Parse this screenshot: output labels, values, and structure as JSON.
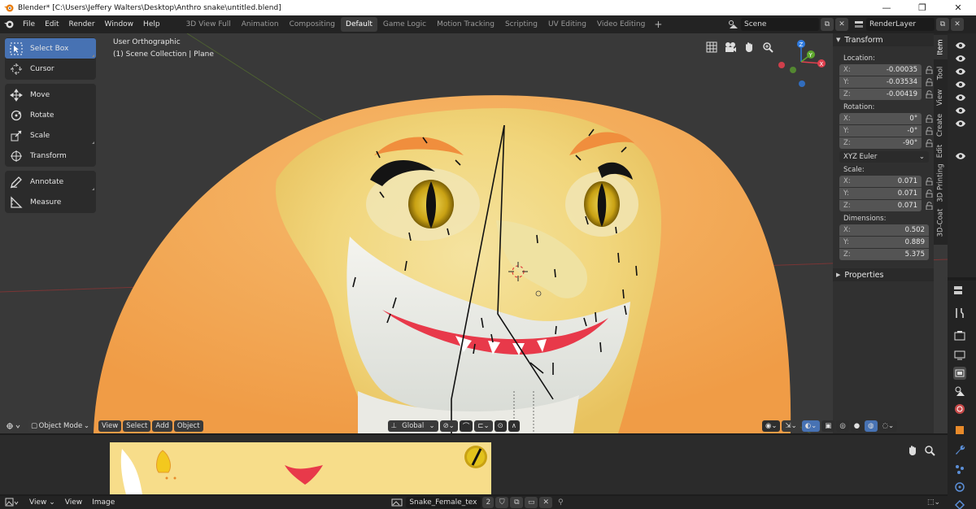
{
  "titlebar": {
    "title": "Blender* [C:\\Users\\Jeffery Walters\\Desktop\\Anthro snake\\untitled.blend]",
    "minimize": "—",
    "maximize": "❐",
    "close": "✕"
  },
  "menus": [
    "File",
    "Edit",
    "Render",
    "Window",
    "Help"
  ],
  "workspaces": [
    "3D View Full",
    "Animation",
    "Compositing",
    "Default",
    "Game Logic",
    "Motion Tracking",
    "Scripting",
    "UV Editing",
    "Video Editing"
  ],
  "active_workspace": "Default",
  "workspace_add": "+",
  "scene": {
    "name": "Scene",
    "render_layer": "RenderLayer"
  },
  "viewport": {
    "view_name": "User Orthographic",
    "collection_info": "(1) Scene Collection | Plane",
    "mode": "Object Mode",
    "menus": [
      "View",
      "Select",
      "Add",
      "Object"
    ],
    "transform_orientation": "Global"
  },
  "tools": {
    "select_box": "Select Box",
    "cursor": "Cursor",
    "move": "Move",
    "rotate": "Rotate",
    "scale": "Scale",
    "transform": "Transform",
    "annotate": "Annotate",
    "measure": "Measure"
  },
  "transform_panel": {
    "title": "Transform",
    "location_label": "Location:",
    "location": {
      "x": "-0.00035",
      "y": "-0.03534",
      "z": "-0.00419"
    },
    "rotation_label": "Rotation:",
    "rotation": {
      "x": "0°",
      "y": "-0°",
      "z": "-90°"
    },
    "rotation_mode": "XYZ Euler",
    "scale_label": "Scale:",
    "scale": {
      "x": "0.071",
      "y": "0.071",
      "z": "0.071"
    },
    "dimensions_label": "Dimensions:",
    "dimensions": {
      "x": "0.502",
      "y": "0.889",
      "z": "5.375"
    },
    "axis_x": "X:",
    "axis_y": "Y:",
    "axis_z": "Z:"
  },
  "properties_panel": {
    "title": "Properties"
  },
  "sidebar_tabs": [
    "Item",
    "Tool",
    "View",
    "Create",
    "Edit",
    "3D Printing",
    "3D-Coat"
  ],
  "image_editor": {
    "menus": [
      "View",
      "View",
      "Image"
    ],
    "image_name": "Snake_Female_tex",
    "users": "2"
  },
  "colors": {
    "accent": "#4772b3",
    "viewport_bg": "#393939",
    "skin_orange": "#f3a85a",
    "skin_yellow": "#f2dd8a",
    "mouth_red": "#e8394a",
    "eye_yellow": "#e2c21c"
  }
}
